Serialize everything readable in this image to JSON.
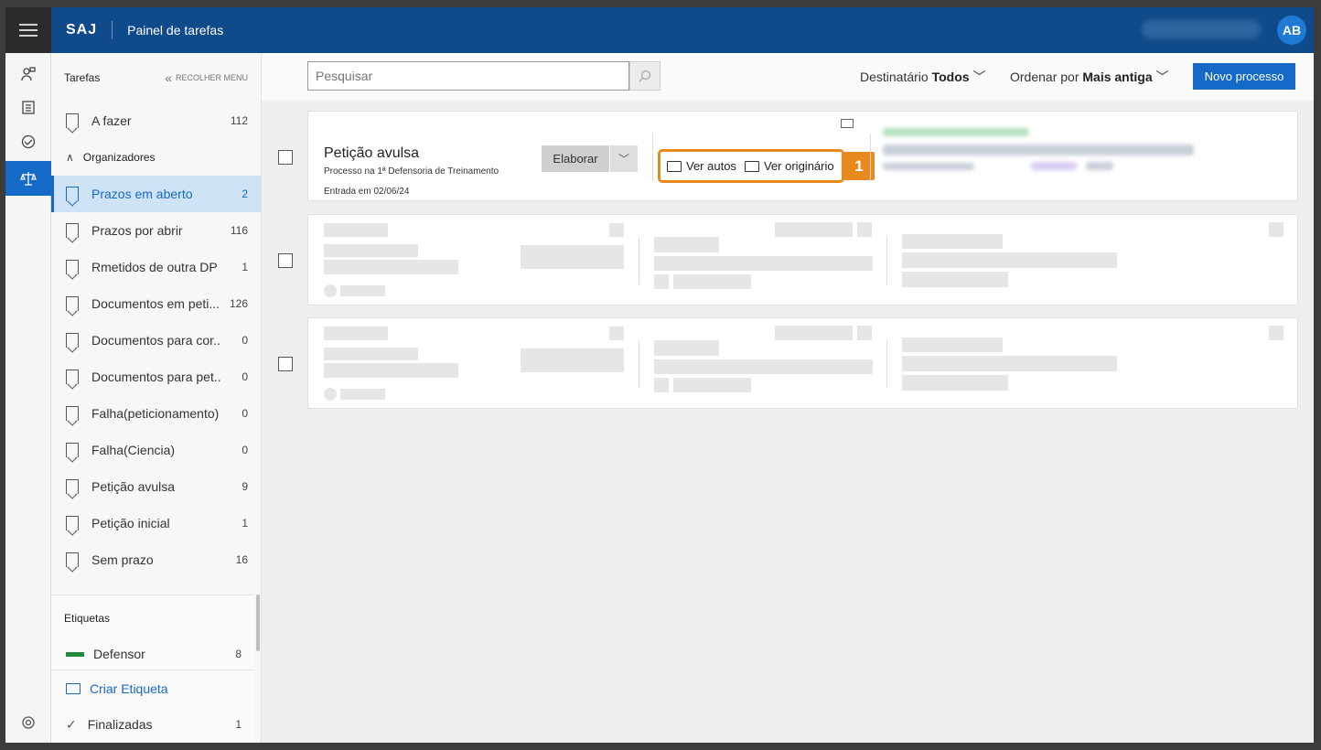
{
  "header": {
    "brand": "SAJ",
    "title": "Painel de tarefas",
    "avatar_initials": "AB"
  },
  "sidebar": {
    "heading": "Tarefas",
    "collapse_label": "RECOLHER MENU",
    "items_top": [
      {
        "label": "A fazer",
        "count": "112"
      }
    ],
    "organizadores_label": "Organizadores",
    "items": [
      {
        "label": "Prazos em aberto",
        "count": "2",
        "active": true
      },
      {
        "label": "Prazos por abrir",
        "count": "116"
      },
      {
        "label": "Rmetidos de outra DP",
        "count": "1"
      },
      {
        "label": "Documentos em peti...",
        "count": "126"
      },
      {
        "label": "Documentos para cor..",
        "count": "0"
      },
      {
        "label": "Documentos para pet..",
        "count": "0"
      },
      {
        "label": "Falha(peticionamento)",
        "count": "0"
      },
      {
        "label": "Falha(Ciencia)",
        "count": "0"
      },
      {
        "label": "Petição avulsa",
        "count": "9"
      },
      {
        "label": "Petição inicial",
        "count": "1"
      },
      {
        "label": "Sem prazo",
        "count": "16"
      }
    ],
    "etiquetas_label": "Etiquetas",
    "tags": [
      {
        "label": "Defensor",
        "count": "8",
        "color": "#1f8a3b"
      }
    ],
    "create_tag_label": "Criar Etiqueta",
    "finalizadas": {
      "label": "Finalizadas",
      "count": "1"
    }
  },
  "toolbar": {
    "search_placeholder": "Pesquisar",
    "destinatario_label": "Destinatário",
    "destinatario_value": "Todos",
    "ordenar_label": "Ordenar por",
    "ordenar_value": "Mais antiga",
    "novo_label": "Novo processo"
  },
  "card": {
    "title": "Petição avulsa",
    "subtitle": "Processo na 1ª Defensoria de Treinamento",
    "date": "Entrada em 02/06/24",
    "elaborar_label": "Elaborar",
    "ver_autos_label": "Ver autos",
    "ver_originario_label": "Ver originário",
    "step_badge": "1"
  },
  "colors": {
    "header": "#0f4a8a",
    "accent": "#1569c7",
    "highlight": "#e8891e"
  }
}
